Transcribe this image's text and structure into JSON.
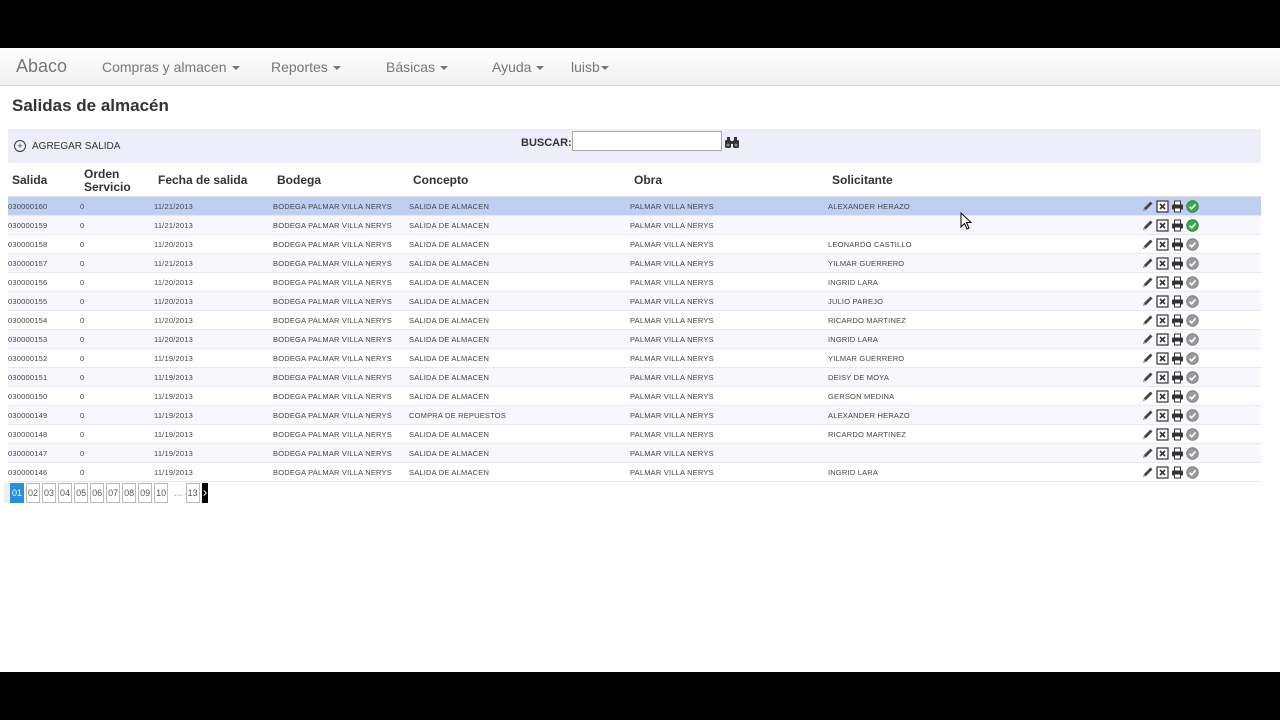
{
  "navbar": {
    "brand": "Abaco",
    "items": [
      {
        "label": "Compras y almacen",
        "caret": true
      },
      {
        "label": "Reportes",
        "caret": true
      },
      {
        "label": "Básicas",
        "caret": true
      },
      {
        "label": "Ayuda",
        "caret": true
      },
      {
        "label": "luisb",
        "caret": true
      }
    ]
  },
  "page": {
    "title": "Salidas de almacén",
    "add_label": "AGREGAR SALIDA",
    "search_label": "BUSCAR:",
    "search_value": "",
    "search_placeholder": ""
  },
  "table": {
    "headers": [
      "Salida",
      "Orden Servicio",
      "Fecha de salida",
      "Bodega",
      "Concepto",
      "Obra",
      "Solicitante"
    ],
    "rows": [
      {
        "salida": "030000160",
        "orden": "0",
        "fecha": "11/21/2013",
        "bodega": "BODEGA PALMAR VILLA NERYS",
        "concepto": "SALIDA DE ALMACEN",
        "obra": "PALMAR VILLA NERYS",
        "solicitante": "ALEXANDER HERAZO",
        "approved": true
      },
      {
        "salida": "030000159",
        "orden": "0",
        "fecha": "11/21/2013",
        "bodega": "BODEGA PALMAR VILLA NERYS",
        "concepto": "SALIDA DE ALMACEN",
        "obra": "PALMAR VILLA NERYS",
        "solicitante": "",
        "approved": true
      },
      {
        "salida": "030000158",
        "orden": "0",
        "fecha": "11/20/2013",
        "bodega": "BODEGA PALMAR VILLA NERYS",
        "concepto": "SALIDA DE ALMACEN",
        "obra": "PALMAR VILLA NERYS",
        "solicitante": "LEONARDO CASTILLO",
        "approved": false
      },
      {
        "salida": "030000157",
        "orden": "0",
        "fecha": "11/21/2013",
        "bodega": "BODEGA PALMAR VILLA NERYS",
        "concepto": "SALIDA DE ALMACEN",
        "obra": "PALMAR VILLA NERYS",
        "solicitante": "YILMAR GUERRERO",
        "approved": false
      },
      {
        "salida": "030000156",
        "orden": "0",
        "fecha": "11/20/2013",
        "bodega": "BODEGA PALMAR VILLA NERYS",
        "concepto": "SALIDA DE ALMACEN",
        "obra": "PALMAR VILLA NERYS",
        "solicitante": "INGRID LARA",
        "approved": false
      },
      {
        "salida": "030000155",
        "orden": "0",
        "fecha": "11/20/2013",
        "bodega": "BODEGA PALMAR VILLA NERYS",
        "concepto": "SALIDA DE ALMACEN",
        "obra": "PALMAR VILLA NERYS",
        "solicitante": "JULIO PAREJO",
        "approved": false
      },
      {
        "salida": "030000154",
        "orden": "0",
        "fecha": "11/20/2013",
        "bodega": "BODEGA PALMAR VILLA NERYS",
        "concepto": "SALIDA DE ALMACEN",
        "obra": "PALMAR VILLA NERYS",
        "solicitante": "RICARDO MARTINEZ",
        "approved": false
      },
      {
        "salida": "030000153",
        "orden": "0",
        "fecha": "11/20/2013",
        "bodega": "BODEGA PALMAR VILLA NERYS",
        "concepto": "SALIDA DE ALMACEN",
        "obra": "PALMAR VILLA NERYS",
        "solicitante": "INGRID LARA",
        "approved": false
      },
      {
        "salida": "030000152",
        "orden": "0",
        "fecha": "11/19/2013",
        "bodega": "BODEGA PALMAR VILLA NERYS",
        "concepto": "SALIDA DE ALMACEN",
        "obra": "PALMAR VILLA NERYS",
        "solicitante": "YILMAR GUERRERO",
        "approved": false
      },
      {
        "salida": "030000151",
        "orden": "0",
        "fecha": "11/19/2013",
        "bodega": "BODEGA PALMAR VILLA NERYS",
        "concepto": "SALIDA DE ALMACEN",
        "obra": "PALMAR VILLA NERYS",
        "solicitante": "DEISY DE MOYA",
        "approved": false
      },
      {
        "salida": "030000150",
        "orden": "0",
        "fecha": "11/19/2013",
        "bodega": "BODEGA PALMAR VILLA NERYS",
        "concepto": "SALIDA DE ALMACEN",
        "obra": "PALMAR VILLA NERYS",
        "solicitante": "GERSON MEDINA",
        "approved": false
      },
      {
        "salida": "030000149",
        "orden": "0",
        "fecha": "11/19/2013",
        "bodega": "BODEGA PALMAR VILLA NERYS",
        "concepto": "COMPRA DE REPUESTOS",
        "obra": "PALMAR VILLA NERYS",
        "solicitante": "ALEXANDER HERAZO",
        "approved": false
      },
      {
        "salida": "030000148",
        "orden": "0",
        "fecha": "11/19/2013",
        "bodega": "BODEGA PALMAR VILLA NERYS",
        "concepto": "SALIDA DE ALMACEN",
        "obra": "PALMAR VILLA NERYS",
        "solicitante": "RICARDO MARTINEZ",
        "approved": false
      },
      {
        "salida": "030000147",
        "orden": "0",
        "fecha": "11/19/2013",
        "bodega": "BODEGA PALMAR VILLA NERYS",
        "concepto": "SALIDA DE ALMACEN",
        "obra": "PALMAR VILLA NERYS",
        "solicitante": "",
        "approved": false
      },
      {
        "salida": "030000146",
        "orden": "0",
        "fecha": "11/19/2013",
        "bodega": "BODEGA PALMAR VILLA NERYS",
        "concepto": "SALIDA DE ALMACEN",
        "obra": "PALMAR VILLA NERYS",
        "solicitante": "INGRID LARA",
        "approved": false
      }
    ],
    "selected_row": 0
  },
  "pagination": {
    "pages": [
      "01",
      "02",
      "03",
      "04",
      "05",
      "06",
      "07",
      "08",
      "09",
      "10"
    ],
    "ellipsis": "...",
    "last_page": "13",
    "current": "01"
  },
  "icons": {
    "edit": "pencil-icon",
    "delete": "x-box-icon",
    "print": "printer-icon",
    "approve": "check-circle-icon",
    "add": "plus-circle-icon",
    "search": "binoculars-icon"
  },
  "colors": {
    "selected_row": "#bdd0f2",
    "toolbar_bg": "#eeeefa",
    "approved": "#3aa84a",
    "pending": "#9a9a9a",
    "active_page": "#2a8ee0"
  }
}
